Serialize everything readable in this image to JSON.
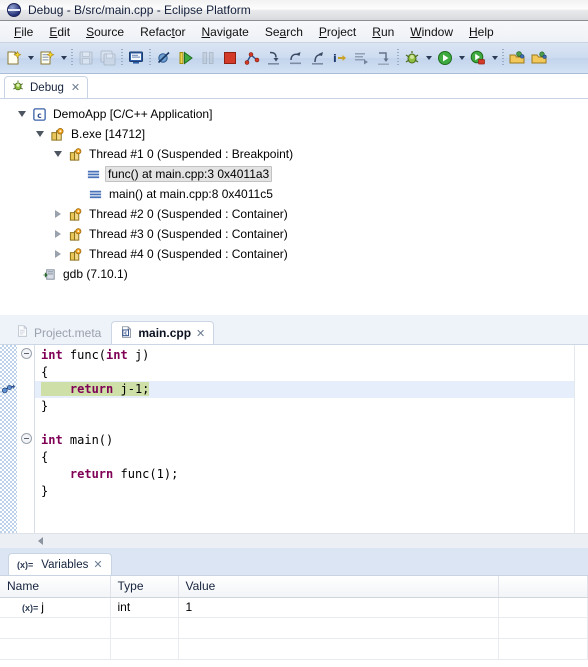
{
  "window": {
    "title": "Debug - B/src/main.cpp - Eclipse Platform",
    "icon": "eclipse-icon"
  },
  "menubar": {
    "items": [
      {
        "label": "File",
        "mnemonic": "F"
      },
      {
        "label": "Edit",
        "mnemonic": "E"
      },
      {
        "label": "Source",
        "mnemonic": "S"
      },
      {
        "label": "Refactor",
        "mnemonic": "t"
      },
      {
        "label": "Navigate",
        "mnemonic": "N"
      },
      {
        "label": "Search",
        "mnemonic": "a"
      },
      {
        "label": "Project",
        "mnemonic": "P"
      },
      {
        "label": "Run",
        "mnemonic": "R"
      },
      {
        "label": "Window",
        "mnemonic": "W"
      },
      {
        "label": "Help",
        "mnemonic": "H"
      }
    ]
  },
  "toolbar": {
    "items": [
      {
        "name": "new-c-project-button",
        "icon": "new-file-icon",
        "enabled": true
      },
      {
        "name": "new-dropdown",
        "icon": "chevron-down-icon",
        "enabled": true
      },
      {
        "name": "new-class-button",
        "icon": "new-class-icon",
        "enabled": true
      },
      {
        "name": "new-class-dropdown",
        "icon": "chevron-down-icon",
        "enabled": true
      },
      {
        "name": "separator-1",
        "icon": "separator",
        "enabled": false
      },
      {
        "name": "save-button",
        "icon": "save-icon",
        "enabled": false
      },
      {
        "name": "save-all-button",
        "icon": "save-all-icon",
        "enabled": false
      },
      {
        "name": "separator-2",
        "icon": "separator",
        "enabled": false
      },
      {
        "name": "console-button",
        "icon": "console-icon",
        "enabled": true
      },
      {
        "name": "separator-3",
        "icon": "separator",
        "enabled": false
      },
      {
        "name": "skip-breakpoints-button",
        "icon": "skip-breakpoints-icon",
        "enabled": true
      },
      {
        "name": "resume-button",
        "icon": "resume-icon",
        "enabled": true
      },
      {
        "name": "suspend-button",
        "icon": "suspend-icon",
        "enabled": false
      },
      {
        "name": "terminate-button",
        "icon": "terminate-icon",
        "enabled": true
      },
      {
        "name": "disconnect-button",
        "icon": "disconnect-icon",
        "enabled": true
      },
      {
        "name": "step-into-button",
        "icon": "step-into-icon",
        "enabled": true
      },
      {
        "name": "step-over-button",
        "icon": "step-over-icon",
        "enabled": true
      },
      {
        "name": "step-return-button",
        "icon": "step-return-icon",
        "enabled": true
      },
      {
        "name": "instruction-stepping-button",
        "icon": "instruction-step-icon",
        "enabled": true
      },
      {
        "name": "step-into-selection-button",
        "icon": "step-into-selection-icon",
        "enabled": true
      },
      {
        "name": "drop-to-frame-button",
        "icon": "drop-to-frame-icon",
        "enabled": true
      },
      {
        "name": "separator-4",
        "icon": "separator",
        "enabled": false
      },
      {
        "name": "debug-button",
        "icon": "debug-bug-icon",
        "enabled": true
      },
      {
        "name": "debug-dropdown",
        "icon": "chevron-down-icon",
        "enabled": true
      },
      {
        "name": "run-button",
        "icon": "run-play-icon",
        "enabled": true
      },
      {
        "name": "run-dropdown",
        "icon": "chevron-down-icon",
        "enabled": true
      },
      {
        "name": "profile-button",
        "icon": "profile-icon",
        "enabled": true
      },
      {
        "name": "profile-dropdown",
        "icon": "chevron-down-icon",
        "enabled": true
      },
      {
        "name": "separator-5",
        "icon": "separator",
        "enabled": false
      },
      {
        "name": "open-resource-button",
        "icon": "open-folder-icon",
        "enabled": true
      },
      {
        "name": "open-element-button",
        "icon": "open-folder-icon-2",
        "enabled": true
      }
    ]
  },
  "debug_view": {
    "tab": {
      "label": "Debug",
      "icon": "debug-bug-icon",
      "close": "✕"
    },
    "tree": [
      {
        "indent": 0,
        "twisty": "open",
        "icon": "c-launch-icon",
        "label": "DemoApp [C/C++ Application]",
        "selected": false
      },
      {
        "indent": 1,
        "twisty": "open",
        "icon": "process-icon",
        "label": "B.exe [14712]",
        "selected": false
      },
      {
        "indent": 2,
        "twisty": "open",
        "icon": "thread-icon",
        "label": "Thread #1 0 (Suspended : Breakpoint)",
        "selected": false
      },
      {
        "indent": 3,
        "twisty": "none",
        "icon": "stackframe-icon",
        "label": "func() at main.cpp:3 0x4011a3",
        "selected": true
      },
      {
        "indent": 3,
        "twisty": "none",
        "icon": "stackframe-icon",
        "label": "main() at main.cpp:8 0x4011c5",
        "selected": false
      },
      {
        "indent": 2,
        "twisty": "closed",
        "icon": "thread-icon",
        "label": "Thread #2 0 (Suspended : Container)",
        "selected": false
      },
      {
        "indent": 2,
        "twisty": "closed",
        "icon": "thread-icon",
        "label": "Thread #3 0 (Suspended : Container)",
        "selected": false
      },
      {
        "indent": 2,
        "twisty": "closed",
        "icon": "thread-icon",
        "label": "Thread #4 0 (Suspended : Container)",
        "selected": false
      },
      {
        "indent": 1,
        "twisty": "none",
        "icon": "gdb-icon",
        "label": "gdb (7.10.1)",
        "selected": false
      }
    ]
  },
  "editor": {
    "tabs": [
      {
        "label": "Project.meta",
        "icon": "file-icon",
        "active": false,
        "close": ""
      },
      {
        "label": "main.cpp",
        "icon": "cpp-file-icon",
        "active": true,
        "close": "✕"
      }
    ],
    "code_lines": [
      {
        "fold": true,
        "current": false,
        "tokens": [
          {
            "t": "int",
            "c": "kw"
          },
          {
            "t": " func(",
            "c": ""
          },
          {
            "t": "int",
            "c": "kw"
          },
          {
            "t": " j)",
            "c": ""
          }
        ]
      },
      {
        "fold": false,
        "current": false,
        "tokens": [
          {
            "t": "{",
            "c": ""
          }
        ]
      },
      {
        "fold": false,
        "current": true,
        "tokens": [
          {
            "t": "    ",
            "c": ""
          },
          {
            "t": "return",
            "c": "kw"
          },
          {
            "t": " j-1;",
            "c": ""
          }
        ]
      },
      {
        "fold": false,
        "current": false,
        "tokens": [
          {
            "t": "}",
            "c": ""
          }
        ]
      },
      {
        "fold": false,
        "current": false,
        "tokens": [
          {
            "t": "",
            "c": ""
          }
        ]
      },
      {
        "fold": true,
        "current": false,
        "tokens": [
          {
            "t": "int",
            "c": "kw"
          },
          {
            "t": " main()",
            "c": ""
          }
        ]
      },
      {
        "fold": false,
        "current": false,
        "tokens": [
          {
            "t": "{",
            "c": ""
          }
        ]
      },
      {
        "fold": false,
        "current": false,
        "tokens": [
          {
            "t": "    ",
            "c": ""
          },
          {
            "t": "return",
            "c": "kw"
          },
          {
            "t": " func(1);",
            "c": ""
          }
        ]
      },
      {
        "fold": false,
        "current": false,
        "tokens": [
          {
            "t": "}",
            "c": ""
          }
        ]
      }
    ],
    "highlight_line_index": 2,
    "gutter_marker": "debug-current-instruction-icon"
  },
  "variables_view": {
    "tab": {
      "label": "Variables",
      "icon": "variables-icon",
      "close": "✕"
    },
    "columns": [
      "Name",
      "Type",
      "Value"
    ],
    "rows": [
      {
        "name": "j",
        "type": "int",
        "value": "1",
        "icon": "variable-icon"
      }
    ],
    "empty_rows": 3
  },
  "colors": {
    "title_bar": "#f2f2f2",
    "toolbar": "#cddcf0",
    "tab_strip": "#dbe5f3",
    "current_line": "#e6eefb",
    "highlight_selection": "#cfdfa8",
    "keyword": "#7f0055",
    "tree_selection": "#e4e4e4",
    "panel_border": "#c8d4e4"
  }
}
